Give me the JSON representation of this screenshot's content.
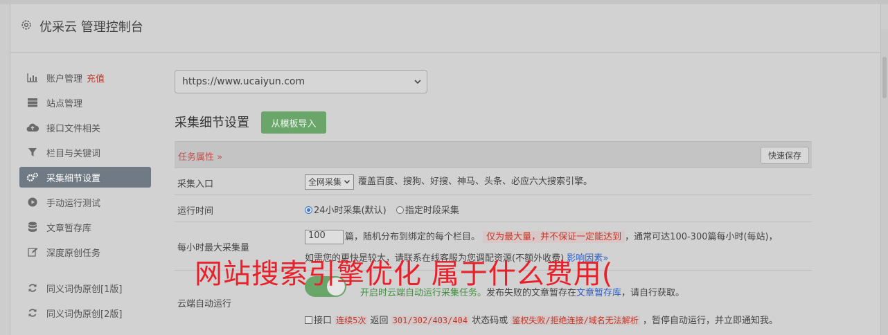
{
  "header": {
    "title": "优采云 管理控制台"
  },
  "sidebar": {
    "items": [
      {
        "label": "账户管理",
        "extra": "充值",
        "icon": "bar-chart-icon"
      },
      {
        "label": "站点管理",
        "icon": "server-icon"
      },
      {
        "label": "接口文件相关",
        "icon": "cloud-upload-icon"
      },
      {
        "label": "栏目与关键词",
        "icon": "filter-icon"
      },
      {
        "label": "采集细节设置",
        "icon": "gears-icon",
        "active": true
      },
      {
        "label": "手动运行测试",
        "icon": "play-circle-icon"
      },
      {
        "label": "文章暂存库",
        "icon": "database-icon"
      },
      {
        "label": "深度原创任务",
        "icon": "edit-icon"
      },
      {
        "label": "同义词伪原创[1版]",
        "icon": "refresh-icon"
      },
      {
        "label": "同义词伪原创[2版]",
        "icon": "refresh-icon"
      }
    ]
  },
  "site_select": {
    "value": "https://www.ucaiyun.com"
  },
  "section": {
    "title": "采集细节设置",
    "import_button": "从模板导入"
  },
  "task_bar": {
    "attr_label": "任务属性 »",
    "save_button": "快速保存"
  },
  "rows": {
    "entry": {
      "label": "采集入口",
      "select": "全网采集",
      "desc": "覆盖百度、搜狗、好搜、神马、头条、必应六大搜索引擎。"
    },
    "time": {
      "label": "运行时间",
      "opt1": "24小时采集(默认)",
      "opt2": "指定时段采集"
    },
    "max": {
      "label": "每小时最大采集量",
      "value": "100",
      "text1": "篇，随机分布到绑定的每个栏目。",
      "highlight": "仅为最大量，并不保证一定能达到",
      "text2": "，通常可达100-300篇每小时(每站)，",
      "line2": "如需您的更快是较大，请联系在线客服为您调配资源(不额外收费)",
      "link": "影响因素"
    },
    "cloud": {
      "label": "云端自动运行",
      "green": "开启时云端自动运行采集任务。",
      "text1": "发布失败的文章暂存在",
      "link": "文章暂存库",
      "text2": "，请自行获取。",
      "check_label": "接口",
      "c1": "连续5次",
      "t1": "返回",
      "c2": "301/302/403/404",
      "t2": "状态码或",
      "c3": "鉴权失败/拒绝连接/域名无法解析",
      "t3": "，暂停自动运行，并立即通知我。"
    }
  },
  "overlay_text": "网站搜索引擎优化 属于什么费用(",
  "colors": {
    "accent_green": "#6aa56a",
    "active_nav": "#6f7a85",
    "warn_red": "#c0392b",
    "link_blue": "#2f5fc4"
  }
}
